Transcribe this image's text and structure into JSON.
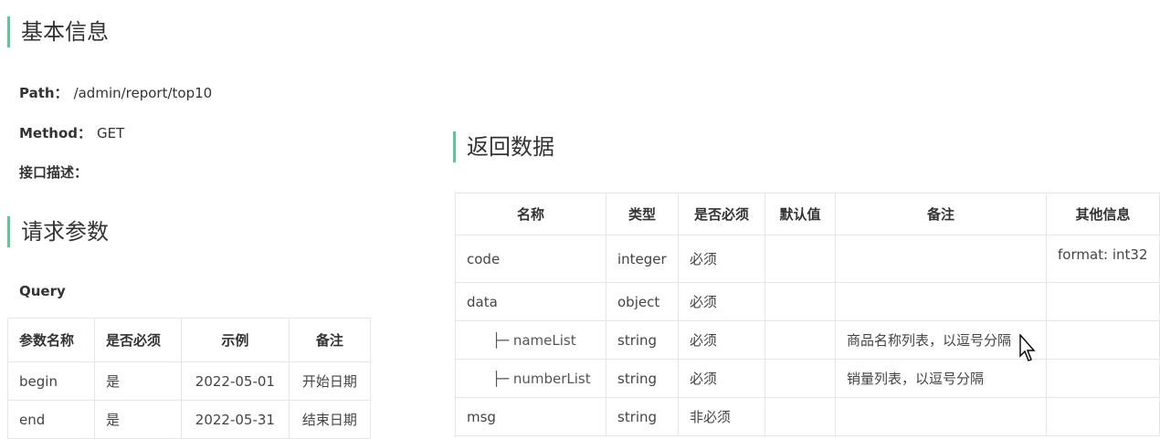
{
  "basic_info": {
    "title": "基本信息",
    "path_label": "Path：",
    "path_value": "/admin/report/top10",
    "method_label": "Method：",
    "method_value": "GET",
    "desc_label": "接口描述："
  },
  "request_params": {
    "title": "请求参数",
    "query_label": "Query",
    "headers": [
      "参数名称",
      "是否必须",
      "示例",
      "备注"
    ],
    "rows": [
      [
        "begin",
        "是",
        "2022-05-01",
        "开始日期"
      ],
      [
        "end",
        "是",
        "2022-05-31",
        "结束日期"
      ]
    ]
  },
  "response": {
    "title": "返回数据",
    "headers": [
      "名称",
      "类型",
      "是否必须",
      "默认值",
      "备注",
      "其他信息"
    ],
    "rows": [
      {
        "name": "code",
        "type": "integer",
        "required": "必须",
        "default": "",
        "note": "",
        "other": "format: int32"
      },
      {
        "name": "data",
        "type": "object",
        "required": "必须",
        "default": "",
        "note": "",
        "other": ""
      },
      {
        "name": "├─ nameList",
        "type": "string",
        "required": "必须",
        "default": "",
        "note": "商品名称列表，以逗号分隔",
        "other": ""
      },
      {
        "name": "├─ numberList",
        "type": "string",
        "required": "必须",
        "default": "",
        "note": "销量列表，以逗号分隔",
        "other": ""
      },
      {
        "name": "msg",
        "type": "string",
        "required": "非必须",
        "default": "",
        "note": "",
        "other": ""
      }
    ]
  }
}
